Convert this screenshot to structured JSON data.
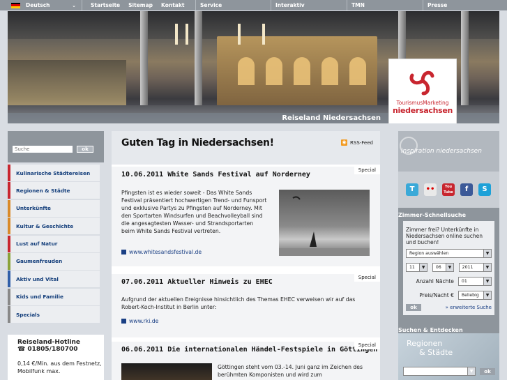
{
  "topnav": {
    "language": "Deutsch",
    "links": [
      "Startseite",
      "Sitemap",
      "Kontakt"
    ],
    "sections": [
      "Service",
      "Interaktiv",
      "TMN",
      "Presse"
    ]
  },
  "hero": {
    "banner": "Reiseland Niedersachsen",
    "logo_line1": "TourismusMarketing",
    "logo_line2": "niedersachsen"
  },
  "search": {
    "placeholder": "Suche",
    "button": "ok"
  },
  "menu": [
    {
      "label": "Kulinarische Städtereisen",
      "color": "#c8262f"
    },
    {
      "label": "Regionen & Städte",
      "color": "#c8262f"
    },
    {
      "label": "Unterkünfte",
      "color": "#d98a2a"
    },
    {
      "label": "Kultur & Geschichte",
      "color": "#d98a2a"
    },
    {
      "label": "Lust auf Natur",
      "color": "#c8262f"
    },
    {
      "label": "Gaumenfreuden",
      "color": "#8aa23a"
    },
    {
      "label": "Aktiv und Vital",
      "color": "#2f5ea8"
    },
    {
      "label": "Kids und Familie",
      "color": "#888888"
    },
    {
      "label": "Specials",
      "color": "#888888"
    }
  ],
  "hotline": {
    "title": "Reiseland-Hotline",
    "phone": "☎ 01805/180700",
    "text": "0,14 €/Min. aus dem Festnetz, Mobilfunk max."
  },
  "main": {
    "title": "Guten Tag in Niedersachsen!",
    "rss": "RSS-Feed",
    "articles": [
      {
        "badge": "Special",
        "title": "10.06.2011 White Sands Festival auf Norderney",
        "text": "Pfingsten ist es wieder soweit - Das White Sands Festival präsentiert hochwertigen Trend- und Funsport und exklusive Partys zu Pfingsten auf Norderney. Mit den Sportarten Windsurfen und Beachvolleyball sind die angesagtesten Wasser- und Strandsportarten beim White Sands Festival vertreten.",
        "link": "www.whitesandsfestival.de"
      },
      {
        "badge": "Special",
        "title": "07.06.2011 Aktueller Hinweis zu EHEC",
        "text": "Aufgrund der aktuellen Ereignisse hinsichtlich des Themas EHEC verweisen wir auf das Robert-Koch-Institut in Berlin unter:",
        "link": "www.rki.de"
      },
      {
        "badge": "Special",
        "title": "06.06.2011 Die internationalen Händel-Festspiele in Göttingen",
        "text": "Göttingen steht vom 03.-14. Juni ganz im Zeichen des berühmten Komponisten und wird zum"
      }
    ]
  },
  "right": {
    "inspiration": "inspiration niedersachsen",
    "social": [
      "T",
      "••",
      "You Tube",
      "f",
      "S"
    ],
    "zimmer_heading": "Zimmer-Schnellsuche",
    "zimmer_text": "Zimmer frei? Unterkünfte in Niedersachsen online suchen und buchen!",
    "region_select": "Region auswählen",
    "day": "11",
    "month": "06",
    "year": "2011",
    "naechte_label": "Anzahl Nächte",
    "naechte_value": "01",
    "preis_label": "Preis/Nacht €",
    "preis_value": "Beliebig",
    "ok": "ok",
    "erweitert": "» erweiterte Suche",
    "suchen_heading": "Suchen & Entdecken",
    "regionen_line1": "Regionen",
    "regionen_line2": "& Städte",
    "region_select2": "Region auswählen",
    "ok2": "ok"
  }
}
